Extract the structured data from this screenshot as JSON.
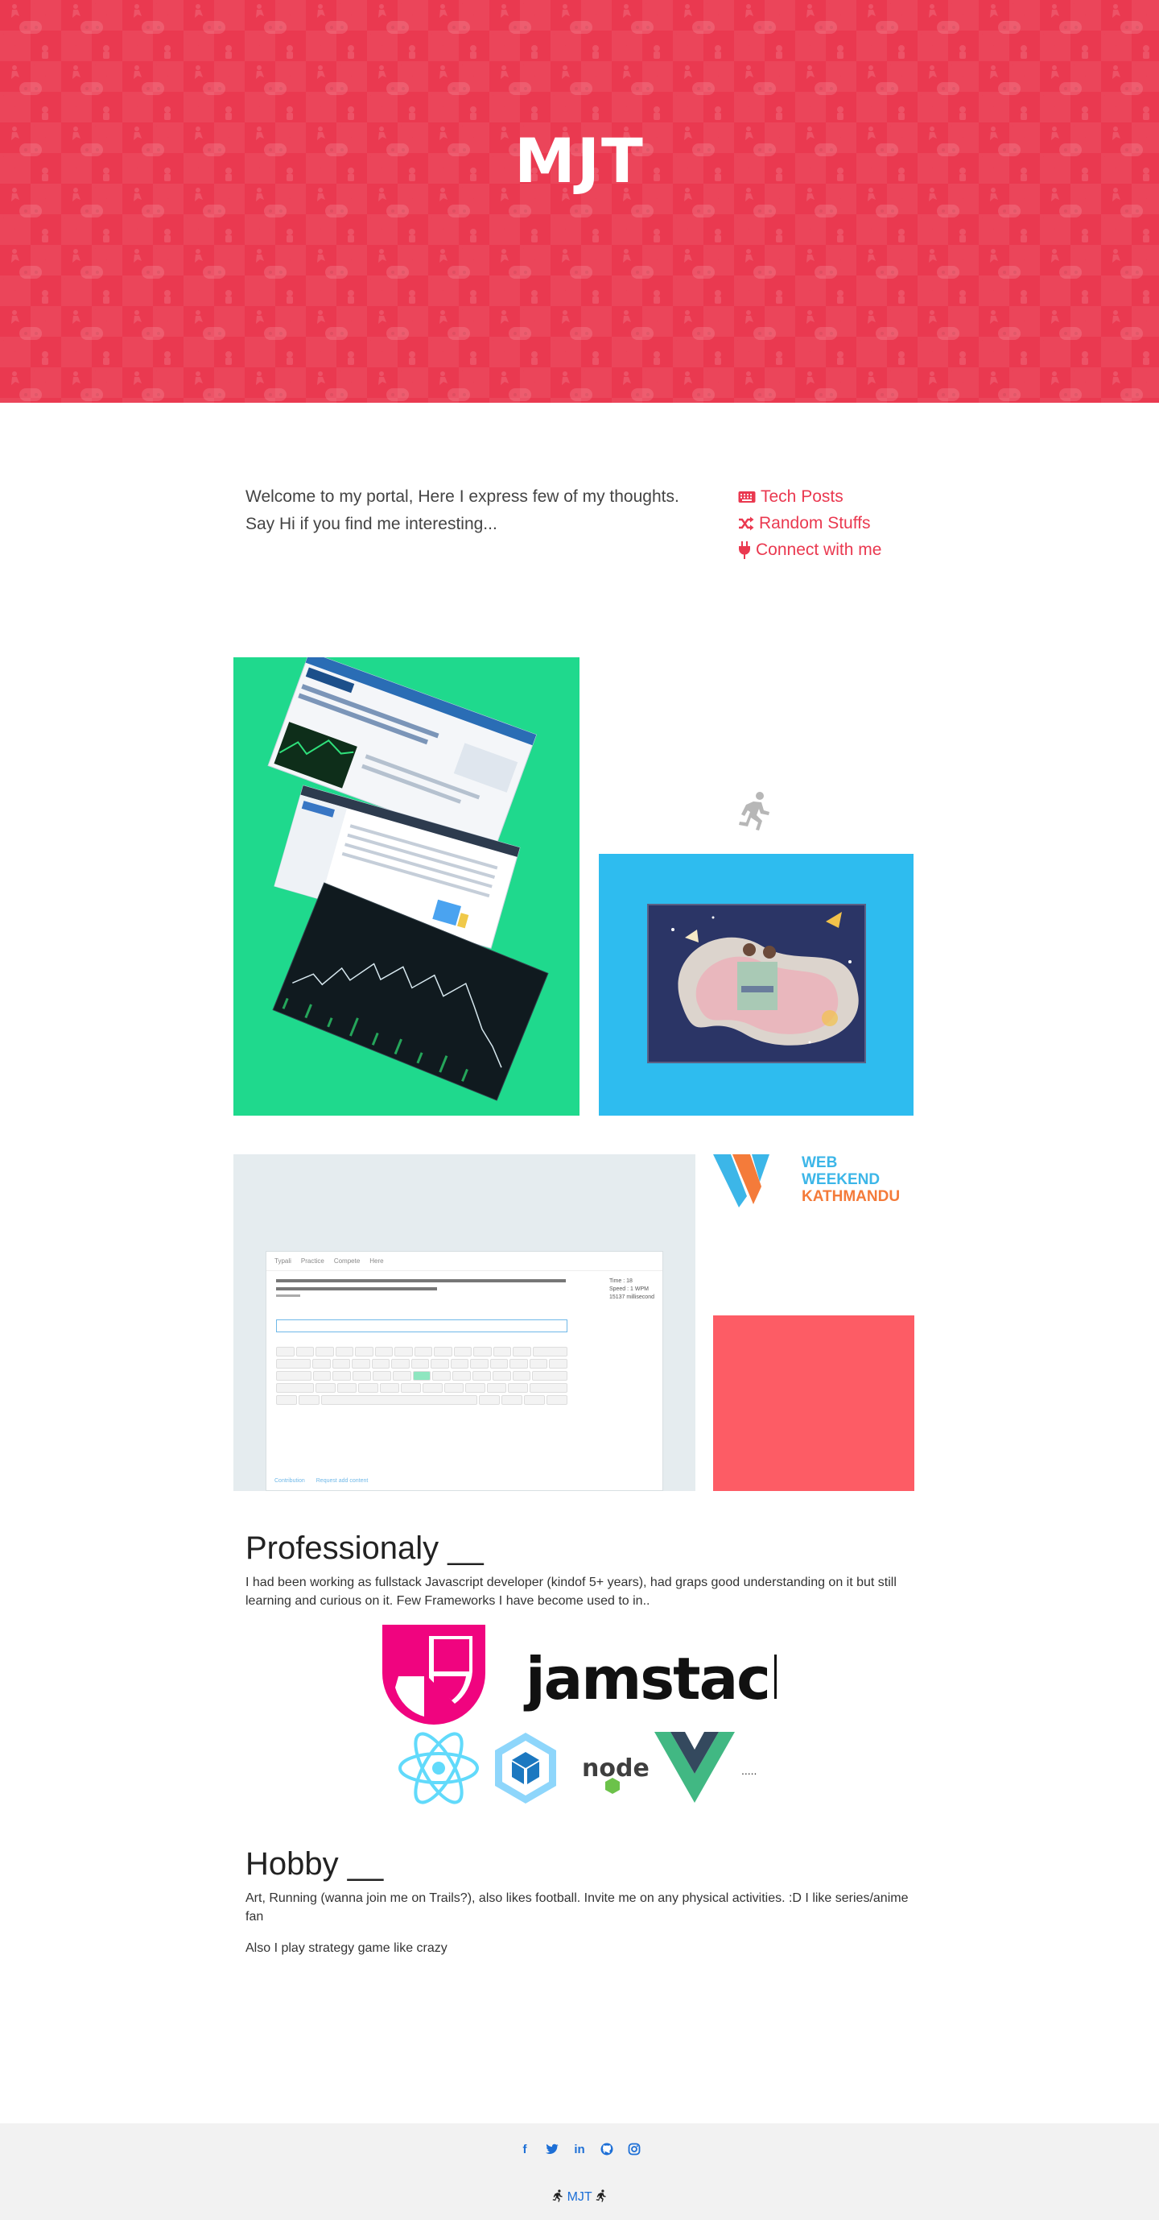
{
  "hero": {
    "title": "MJT"
  },
  "intro": {
    "text_line1": "Welcome to my portal, Here I express few of my thoughts.",
    "text_line2": "Say Hi if you find me interesting...",
    "links": [
      {
        "icon": "keyboard-icon",
        "label": "Tech Posts"
      },
      {
        "icon": "shuffle-icon",
        "label": "Random Stuffs"
      },
      {
        "icon": "plug-icon",
        "label": "Connect with me"
      }
    ]
  },
  "gallery": {
    "typing_nav": [
      "Typali",
      "Practice",
      "Compete",
      "Here"
    ],
    "typing_stats": [
      "Time : 18",
      "Speed : 1 WPM",
      "15137 millisecond"
    ],
    "typing_footer": [
      "Contribution",
      "Request add content"
    ],
    "web_weekend": {
      "line1": "WEB",
      "line2": "WEEKEND",
      "line3": "KATHMANDU"
    }
  },
  "professional": {
    "heading": "Professionaly __",
    "text": "I had been working as fullstack Javascript developer (kindof 5+ years), had graps good understanding on it but still learning and curious on it. Few Frameworks I have become used to in..",
    "jamstack_label": "jamstack",
    "ellipsis": "....."
  },
  "hobby": {
    "heading": "Hobby __",
    "text1": "Art, Running (wanna join me on Trails?), also likes football. Invite me on any physical activities. :D I like series/anime fan",
    "text2": "Also I play strategy game like crazy"
  },
  "footer": {
    "social": [
      "facebook-icon",
      "twitter-icon",
      "linkedin-icon",
      "github-icon",
      "instagram-icon"
    ],
    "brand": "MJT"
  },
  "colors": {
    "brand_red": "#ea3950",
    "green": "#1fd98d",
    "blue": "#2ebcef",
    "coral": "#fd5c65",
    "link_blue": "#1d6fd6"
  }
}
